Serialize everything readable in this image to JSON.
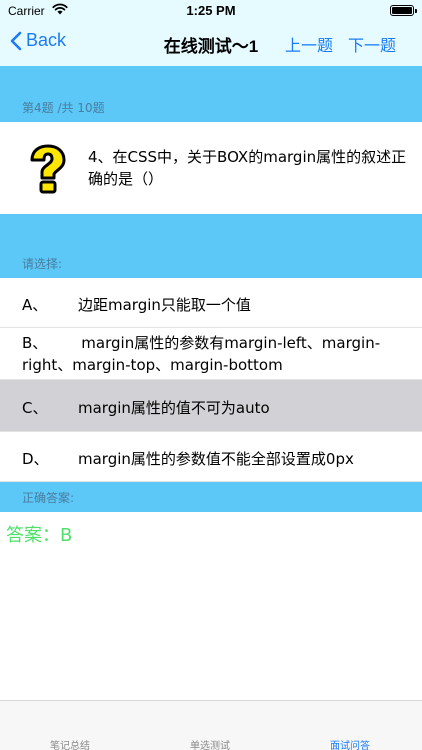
{
  "status": {
    "carrier": "Carrier",
    "time": "1:25 PM"
  },
  "nav": {
    "back_label": "Back",
    "title": "在线测试～1",
    "prev_label": "上一题",
    "next_label": "下一题"
  },
  "progress": {
    "label": "第4题 /共 10题"
  },
  "question": {
    "text": "4、在CSS中，关于BOX的margin属性的叙述正确的是（）",
    "icon": "question-mark-icon"
  },
  "options_header": "请选择:",
  "options": [
    {
      "letter": "A、",
      "text": "边距margin只能取一个值"
    },
    {
      "letter": "B、",
      "text": "margin属性的参数有margin-left、margin-right、margin-top、margin-bottom"
    },
    {
      "letter": "C、",
      "text": "margin属性的值不可为auto"
    },
    {
      "letter": "D、",
      "text": "margin属性的参数值不能全部设置成0px"
    }
  ],
  "selected_option": "C",
  "answer_header": "正确答案:",
  "answer": "答案：B",
  "tabs": [
    {
      "label": "笔记总结",
      "active": false
    },
    {
      "label": "单选测试",
      "active": false
    },
    {
      "label": "面试问答",
      "active": true
    }
  ],
  "colors": {
    "accent": "#1a7cf5",
    "band": "#5bc8f7",
    "answer": "#4ee06a",
    "nav_bg": "#e6fbff",
    "selected_bg": "#d2d2d6"
  }
}
